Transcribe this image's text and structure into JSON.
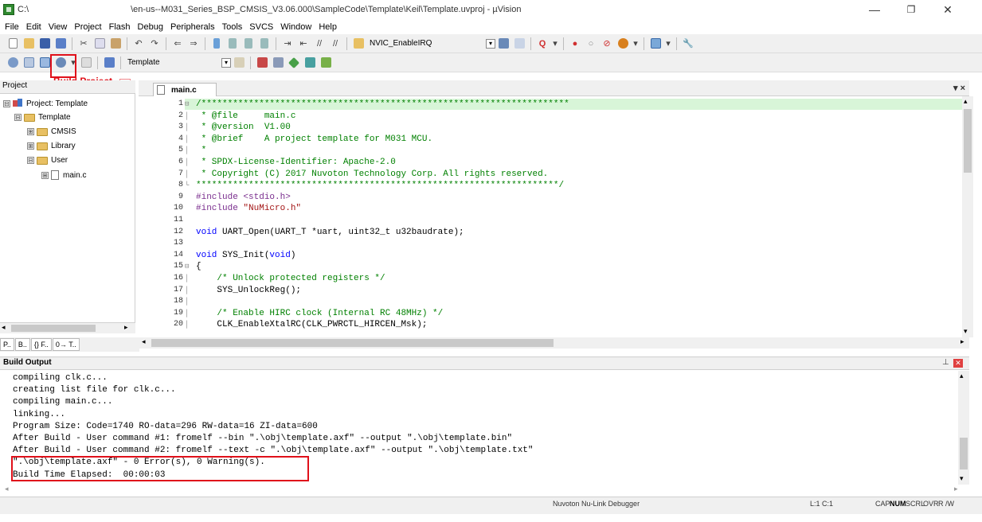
{
  "window": {
    "title_prefix": "C:\\",
    "title": "\\en-us--M031_Series_BSP_CMSIS_V3.06.000\\SampleCode\\Template\\Keil\\Template.uvproj - µVision",
    "minimize": "—",
    "maximize": "❐",
    "close": "✕"
  },
  "menu": [
    "File",
    "Edit",
    "View",
    "Project",
    "Flash",
    "Debug",
    "Peripherals",
    "Tools",
    "SVCS",
    "Window",
    "Help"
  ],
  "toolbar1": {
    "nvic_label": "NVIC_EnableIRQ"
  },
  "toolbar2": {
    "target_name": "Template"
  },
  "annotation": {
    "build_project_label": "Build Project"
  },
  "project_panel": {
    "header": "Project",
    "tree": [
      {
        "label": "Project: Template",
        "level": 0,
        "type": "project",
        "toggle": "⊟"
      },
      {
        "label": "Template",
        "level": 1,
        "type": "folder",
        "toggle": "⊟"
      },
      {
        "label": "CMSIS",
        "level": 2,
        "type": "folder",
        "toggle": "⊞"
      },
      {
        "label": "Library",
        "level": 2,
        "type": "folder",
        "toggle": "⊞"
      },
      {
        "label": "User",
        "level": 2,
        "type": "folder",
        "toggle": "⊟"
      },
      {
        "label": "main.c",
        "level": 3,
        "type": "file",
        "toggle": "⊞"
      }
    ],
    "tabs": [
      "P..",
      "B..",
      "{} F..",
      "0→ T.."
    ]
  },
  "editor": {
    "tab_label": "main.c",
    "lines": [
      {
        "n": "1",
        "fold": "⊟",
        "segments": [
          {
            "t": "/**********************************************************************",
            "c": "comment"
          }
        ]
      },
      {
        "n": "2",
        "fold": "│",
        "segments": [
          {
            "t": " * @file     main.c",
            "c": "comment"
          }
        ]
      },
      {
        "n": "3",
        "fold": "│",
        "segments": [
          {
            "t": " * @version  V1.00",
            "c": "comment"
          }
        ]
      },
      {
        "n": "4",
        "fold": "│",
        "segments": [
          {
            "t": " * @brief    A project template for M031 MCU.",
            "c": "comment"
          }
        ]
      },
      {
        "n": "5",
        "fold": "│",
        "segments": [
          {
            "t": " *",
            "c": "comment"
          }
        ]
      },
      {
        "n": "6",
        "fold": "│",
        "segments": [
          {
            "t": " * SPDX-License-Identifier: Apache-2.0",
            "c": "comment"
          }
        ]
      },
      {
        "n": "7",
        "fold": "│",
        "segments": [
          {
            "t": " * Copyright (C) 2017 Nuvoton Technology Corp. All rights reserved.",
            "c": "comment"
          }
        ]
      },
      {
        "n": "8",
        "fold": "└",
        "segments": [
          {
            "t": "*********************************************************************/",
            "c": "comment"
          }
        ]
      },
      {
        "n": "9",
        "fold": "",
        "segments": [
          {
            "t": "#include ",
            "c": "pp"
          },
          {
            "t": "<stdio.h>",
            "c": "pp"
          }
        ]
      },
      {
        "n": "10",
        "fold": "",
        "segments": [
          {
            "t": "#include ",
            "c": "pp"
          },
          {
            "t": "\"NuMicro.h\"",
            "c": "str"
          }
        ]
      },
      {
        "n": "11",
        "fold": "",
        "segments": [
          {
            "t": "",
            "c": ""
          }
        ]
      },
      {
        "n": "12",
        "fold": "",
        "segments": [
          {
            "t": "void",
            "c": "kw"
          },
          {
            "t": " UART_Open(UART_T *uart, uint32_t u32baudrate);",
            "c": ""
          }
        ]
      },
      {
        "n": "13",
        "fold": "",
        "segments": [
          {
            "t": "",
            "c": ""
          }
        ]
      },
      {
        "n": "14",
        "fold": "",
        "segments": [
          {
            "t": "void",
            "c": "kw"
          },
          {
            "t": " SYS_Init(",
            "c": ""
          },
          {
            "t": "void",
            "c": "kw"
          },
          {
            "t": ")",
            "c": ""
          }
        ]
      },
      {
        "n": "15",
        "fold": "⊟",
        "segments": [
          {
            "t": "{",
            "c": ""
          }
        ]
      },
      {
        "n": "16",
        "fold": "│",
        "segments": [
          {
            "t": "    /* Unlock protected registers */",
            "c": "comment"
          }
        ]
      },
      {
        "n": "17",
        "fold": "│",
        "segments": [
          {
            "t": "    SYS_UnlockReg();",
            "c": ""
          }
        ]
      },
      {
        "n": "18",
        "fold": "│",
        "segments": [
          {
            "t": "",
            "c": ""
          }
        ]
      },
      {
        "n": "19",
        "fold": "│",
        "segments": [
          {
            "t": "    /* Enable HIRC clock (Internal RC 48MHz) */",
            "c": "comment"
          }
        ]
      },
      {
        "n": "20",
        "fold": "│",
        "segments": [
          {
            "t": "    CLK_EnableXtalRC(CLK_PWRCTL_HIRCEN_Msk);",
            "c": ""
          }
        ]
      }
    ]
  },
  "build_output": {
    "title": "Build Output",
    "lines": [
      "compiling clk.c...",
      "creating list file for clk.c...",
      "compiling main.c...",
      "linking...",
      "Program Size: Code=1740 RO-data=296 RW-data=16 ZI-data=600",
      "After Build - User command #1: fromelf --bin \".\\obj\\template.axf\" --output \".\\obj\\template.bin\"",
      "After Build - User command #2: fromelf --text -c \".\\obj\\template.axf\" --output \".\\obj\\template.txt\"",
      "\".\\obj\\template.axf\" - 0 Error(s), 0 Warning(s).",
      "Build Time Elapsed:  00:00:03"
    ]
  },
  "status": {
    "debugger": "Nuvoton Nu-Link Debugger",
    "position": "L:1 C:1",
    "cap": "CAP",
    "num": "NUM",
    "scrl": "SCRL",
    "ovr": "OVR",
    "rw": "R /W"
  },
  "colors": {
    "annotation_red": "#e0101a",
    "comment_green": "#008000",
    "keyword_blue": "#0000ff"
  }
}
